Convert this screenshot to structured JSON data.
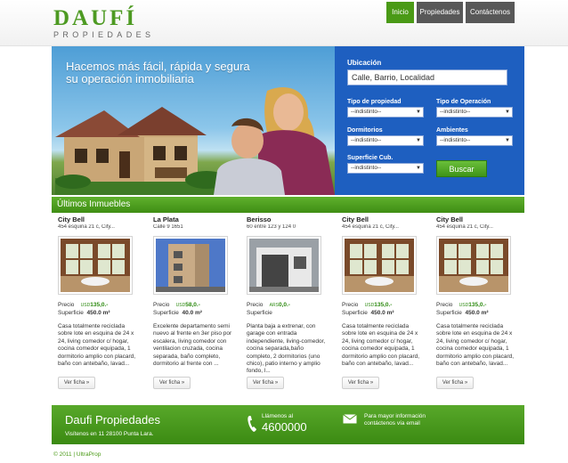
{
  "brand": {
    "name": "DAUFÍ",
    "tagline": "PROPIEDADES"
  },
  "nav": {
    "items": [
      "Inicio",
      "Propiedades",
      "Contáctenos"
    ],
    "active": "Inicio"
  },
  "hero": {
    "headline": "Hacemos más fácil, rápida y segura su operación inmobiliaria"
  },
  "search": {
    "location_label": "Ubicación",
    "location_placeholder": "Calle, Barrio, Localidad",
    "property_type_label": "Tipo de propiedad",
    "property_type_value": "--indistinto--",
    "operation_label": "Tipo de Operación",
    "operation_value": "--indistinto--",
    "bedrooms_label": "Dormitorios",
    "bedrooms_value": "--indistinto--",
    "rooms_label": "Ambientes",
    "rooms_value": "--indistinto--",
    "area_label": "Superficie Cub.",
    "area_value": "--indistinto--",
    "button": "Buscar"
  },
  "section_title": "Últimos Inmuebles",
  "common": {
    "price_label": "Precio",
    "area_label": "Superficie",
    "details_button": "Ver ficha »"
  },
  "listings": [
    {
      "city": "City Bell",
      "address": "454 esquina 21 c, City...",
      "currency": "USD",
      "price": "135,0.-",
      "area": "450.0 m²",
      "description": "Casa totalmente reciclada sobre lote en esquina de 24 x 24, living comedor c/ hogar, cocina comedor equipada, 1 dormitorio amplio con placard, baño con antebaño, lavad..."
    },
    {
      "city": "La Plata",
      "address": "Calle 9 1651",
      "currency": "USD",
      "price": "58,0.-",
      "area": "40.0 m²",
      "description": "Excelente departamento semi nuevo al frente en 3er piso por escalera, living comedor con ventilacion cruzada, cocina separada, baño completo, dormitorio al frente con ..."
    },
    {
      "city": "Berisso",
      "address": "60 entre 123 y 124 0",
      "currency": "ARS",
      "price": "0,0.-",
      "area": "",
      "description": "Planta baja a extrenar, con garage con entrada independiente, living-comedor, cocina separada,baño completo, 2 dormitorios (uno chico), patio interno y amplio fondo, l..."
    },
    {
      "city": "City Bell",
      "address": "454 esquina 21 c, City...",
      "currency": "USD",
      "price": "135,0.-",
      "area": "450.0 m²",
      "description": "Casa totalmente reciclada sobre lote en esquina de 24 x 24, living comedor c/ hogar, cocina comedor equipada, 1 dormitorio amplio con placard, baño con antebaño, lavad..."
    },
    {
      "city": "City Bell",
      "address": "454 esquina 21 c, City...",
      "currency": "USD",
      "price": "135,0.-",
      "area": "450.0 m²",
      "description": "Casa totalmente reciclada sobre lote en esquina de 24 x 24, living comedor c/ hogar, cocina comedor equipada, 1 dormitorio amplio con placard, baño con antebaño, lavad..."
    }
  ],
  "footer": {
    "company": "Daufi Propiedades",
    "address": "Visítenos en 11 28100 Punta Lara.",
    "phone_label": "Llámenos al",
    "phone": "4600000",
    "mail_text": "Para mayor información contáctenos vía email"
  },
  "copyright": "© 2011 | UltraProp",
  "colors": {
    "brand_green": "#4a9a16",
    "search_blue": "#1e5fc0",
    "nav_dark": "#585858"
  }
}
